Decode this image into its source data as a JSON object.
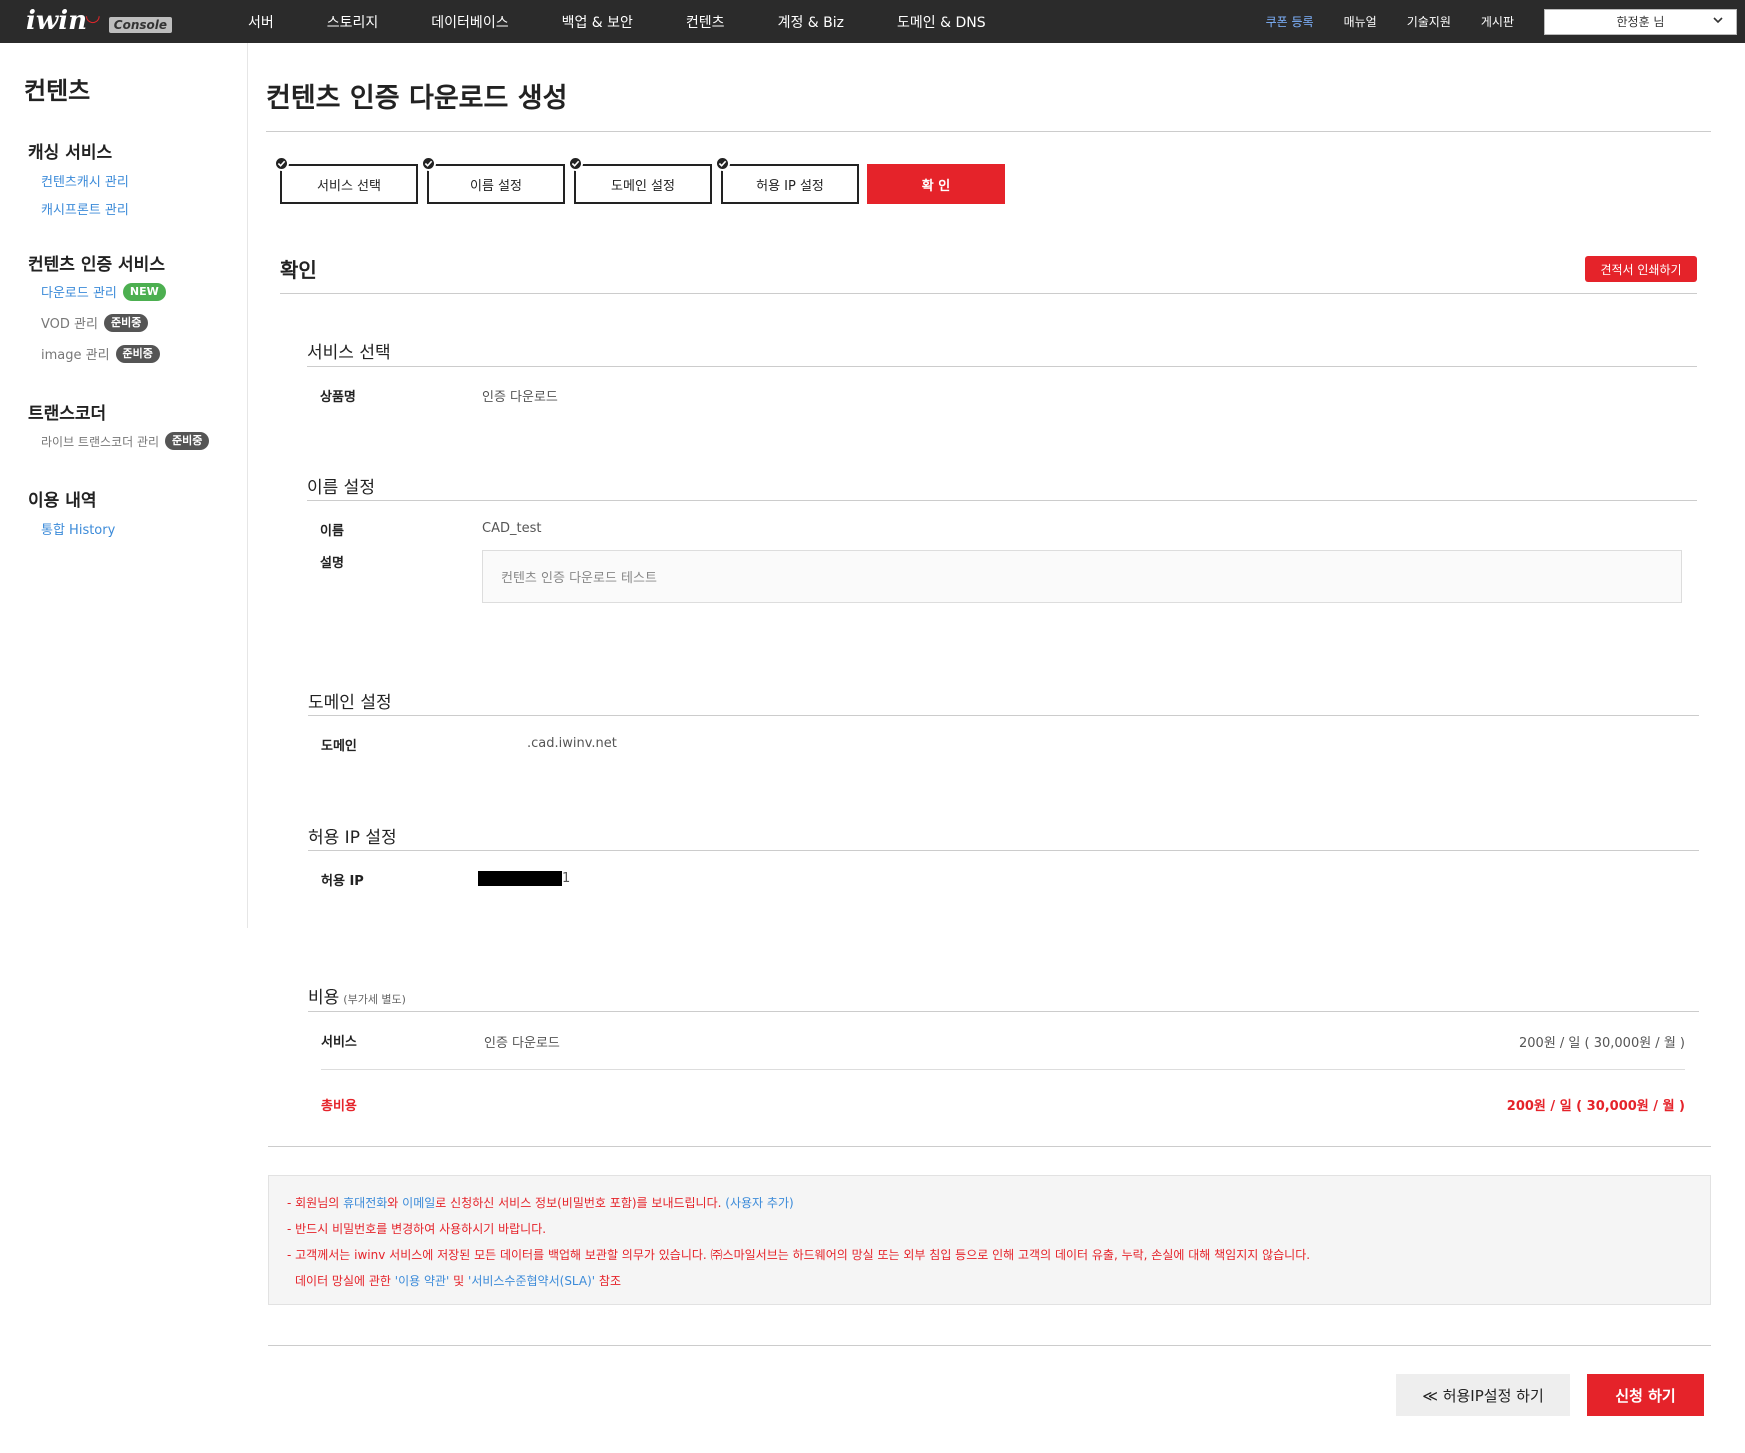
{
  "header": {
    "logo_text": "iwin",
    "logo_badge": "Console",
    "nav": [
      "서버",
      "스토리지",
      "데이터베이스",
      "백업 & 보안",
      "컨텐츠",
      "계정 & Biz",
      "도메인 & DNS"
    ],
    "util": {
      "coupon": "쿠폰 등록",
      "manual": "매뉴얼",
      "support": "기술지원",
      "board": "게시판"
    },
    "user_name": "한정훈 님"
  },
  "sidebar": {
    "title": "컨텐츠",
    "caching_title": "캐싱 서비스",
    "caching_items": [
      "컨텐츠캐시 관리",
      "캐시프론트 관리"
    ],
    "auth_title": "컨텐츠 인증 서비스",
    "auth_items": [
      {
        "label": "다운로드 관리",
        "badge": "NEW"
      },
      {
        "label": "VOD 관리",
        "badge": "준비중"
      },
      {
        "label": "image 관리",
        "badge": "준비중"
      }
    ],
    "transcoder_title": "트랜스코더",
    "transcoder_item": {
      "label": "라이브 트랜스코더 관리",
      "badge": "준비중"
    },
    "usage_title": "이용 내역",
    "usage_item": "통합 History"
  },
  "main": {
    "page_title": "컨텐츠 인증 다운로드 생성",
    "steps": [
      "서비스 선택",
      "이름 설정",
      "도메인 설정",
      "허용 IP 설정",
      "확 인"
    ],
    "confirm_title": "확인",
    "print_button": "견적서 인쇄하기",
    "service_section": {
      "heading": "서비스 선택",
      "label": "상품명",
      "value": "인증 다운로드"
    },
    "name_section": {
      "heading": "이름 설정",
      "name_label": "이름",
      "name_value": "CAD_test",
      "desc_label": "설명",
      "desc_value": "컨텐츠 인증 다운로드 테스트"
    },
    "domain_section": {
      "heading": "도메인 설정",
      "label": "도메인",
      "value": ".cad.iwinv.net"
    },
    "ip_section": {
      "heading": "허용 IP 설정",
      "label": "허용 IP",
      "value_suffix": "1"
    },
    "cost_section": {
      "heading": "비용",
      "note": "(부가세 별도)",
      "service_label": "서비스",
      "service_name": "인증 다운로드",
      "service_price": "200원 / 일 ( 30,000원 / 월 )",
      "total_label": "총비용",
      "total_price": "200원 / 일 ( 30,000원 / 월 )"
    },
    "notice": {
      "line1_a": "- 회원님의 ",
      "line1_b": "휴대전화",
      "line1_c": "와 ",
      "line1_d": "이메일",
      "line1_e": "로 신청하신 서비스 정보(비밀번호 포함)를 보내드립니다. ",
      "line1_f": "(사용자 추가)",
      "line2": "- 반드시 비밀번호를 변경하여 사용하시기 바랍니다.",
      "line3": "- 고객께서는 iwinv 서비스에 저장된 모든 데이터를 백업해 보관할 의무가 있습니다. ㈜스마일서브는 하드웨어의 망실 또는 외부 침입 등으로 인해 고객의 데이터 유출, 누락, 손실에 대해 책임지지 않습니다.",
      "line4_a": "데이터 망실에 관한 ",
      "line4_b": "'이용 약관'",
      "line4_c": " 및 ",
      "line4_d": "'서비스수준협약서(SLA)'",
      "line4_e": " 참조"
    },
    "prev_button": "≪ 허용IP설정 하기",
    "submit_button": "신청 하기"
  },
  "colors": {
    "accent": "#e5232a",
    "link": "#3c8bd9",
    "topbar": "#2b2b2b",
    "new_badge": "#4caf50"
  }
}
